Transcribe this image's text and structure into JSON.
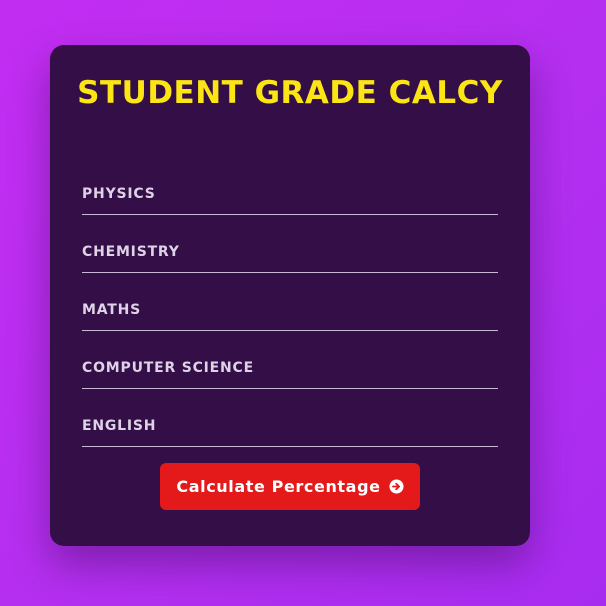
{
  "page": {
    "title": "STUDENT GRADE CALCY"
  },
  "form": {
    "fields": [
      {
        "label": "PHYSICS",
        "value": ""
      },
      {
        "label": "CHEMISTRY",
        "value": ""
      },
      {
        "label": "MATHS",
        "value": ""
      },
      {
        "label": "COMPUTER SCIENCE",
        "value": ""
      },
      {
        "label": "ENGLISH",
        "value": ""
      }
    ],
    "submit_label": "Calculate Percentage",
    "submit_icon": "arrow-circle-right-icon"
  },
  "colors": {
    "background_start": "#c32df2",
    "background_end": "#a82cf0",
    "card": "#330e47",
    "title": "#fce514",
    "label": "#ded3e6",
    "button": "#e41a1a",
    "button_text": "#ffffff"
  }
}
